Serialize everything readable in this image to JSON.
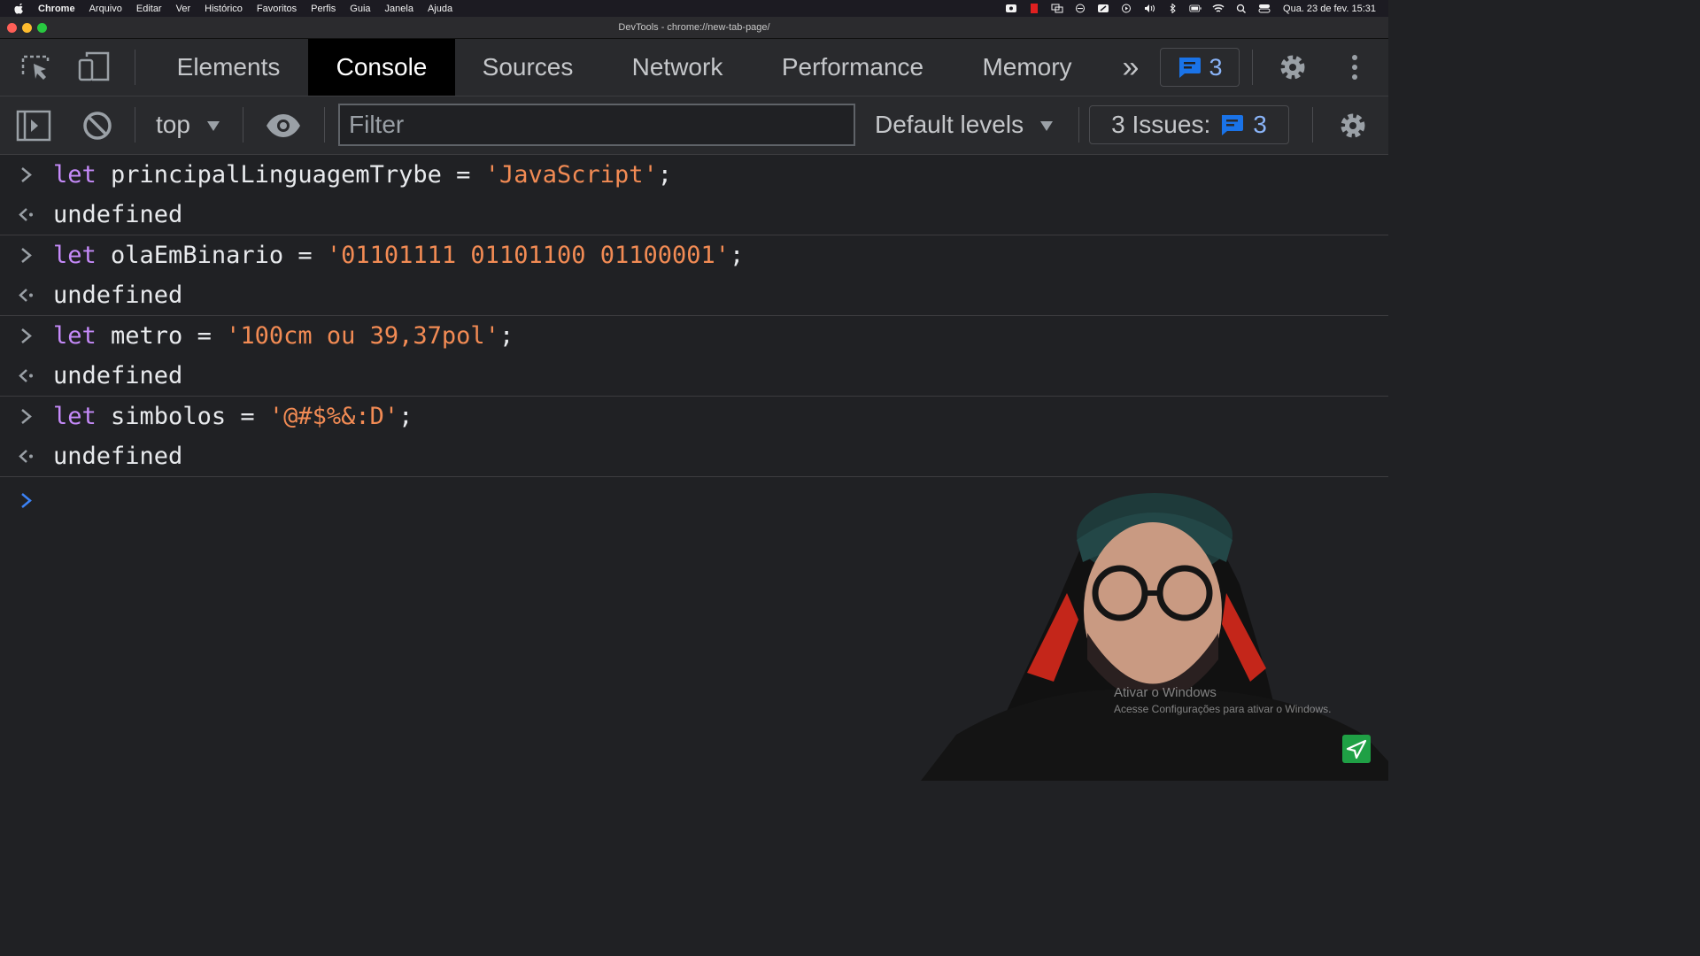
{
  "menubar": {
    "app": "Chrome",
    "items": [
      "Arquivo",
      "Editar",
      "Ver",
      "Histórico",
      "Favoritos",
      "Perfis",
      "Guia",
      "Janela",
      "Ajuda"
    ],
    "clock": "Qua. 23 de fev.  15:31"
  },
  "window": {
    "title": "DevTools - chrome://new-tab-page/"
  },
  "devtools": {
    "tabs": [
      {
        "label": "Elements"
      },
      {
        "label": "Console",
        "active": true
      },
      {
        "label": "Sources"
      },
      {
        "label": "Network"
      },
      {
        "label": "Performance"
      },
      {
        "label": "Memory"
      }
    ],
    "more": "»",
    "messages_count": "3"
  },
  "console_toolbar": {
    "context": "top",
    "filter_placeholder": "Filter",
    "levels": "Default levels",
    "issues_label": "3 Issues:",
    "issues_count": "3"
  },
  "console": {
    "entries": [
      {
        "keyword": "let",
        "name": " principalLinguagemTrybe = ",
        "string": "'JavaScript'",
        "tail": ";",
        "result": "undefined"
      },
      {
        "keyword": "let",
        "name": " olaEmBinario = ",
        "string": "'01101111 01101100 01100001'",
        "tail": ";",
        "result": "undefined"
      },
      {
        "keyword": "let",
        "name": " metro = ",
        "string": "'100cm ou 39,37pol'",
        "tail": ";",
        "result": "undefined"
      },
      {
        "keyword": "let",
        "name": " simbolos = ",
        "string": "'@#$%&:D'",
        "tail": ";",
        "result": "undefined"
      }
    ]
  },
  "overlay": {
    "watermark_title": "Ativar o Windows",
    "watermark_sub": "Acesse Configurações para ativar o Windows."
  },
  "colors": {
    "keyword": "#c58af9",
    "string": "#f28b54",
    "result": "#9aa0a6",
    "accent": "#8ab4f8"
  }
}
